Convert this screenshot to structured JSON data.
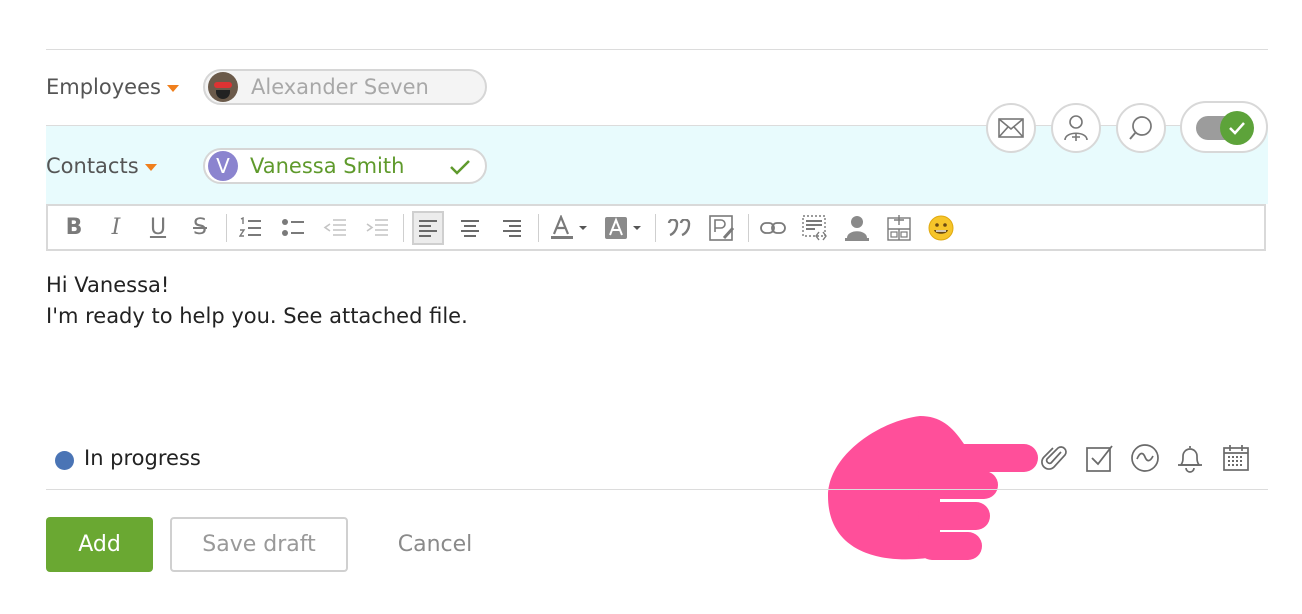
{
  "form": {
    "employees_label": "Employees",
    "employee_chip": "Alexander Seven",
    "contacts_label": "Contacts",
    "contact_chip": "Vanessa Smith",
    "contact_initial": "V"
  },
  "editor": {
    "line1": "Hi Vanessa!",
    "line2": "I'm ready to help you. See attached file."
  },
  "toolbar": {
    "bold": "B",
    "italic": "I",
    "underline": "U",
    "strike": "S"
  },
  "status": {
    "label": "In progress",
    "color": "#4a74b5"
  },
  "actions": {
    "add": "Add",
    "save_draft": "Save draft",
    "cancel": "Cancel"
  },
  "colors": {
    "accent_green": "#6aa832",
    "caret_orange": "#f07f1c",
    "pointer_pink": "#ff4f9a"
  }
}
